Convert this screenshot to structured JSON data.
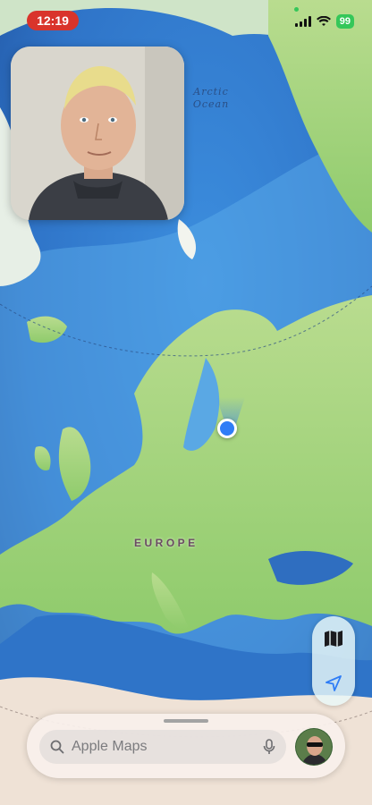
{
  "status_bar": {
    "time": "12:19",
    "battery": "99"
  },
  "map": {
    "ocean_label_line1": "Arctic",
    "ocean_label_line2": "Ocean",
    "region_label": "EUROPE"
  },
  "pip": {
    "icon": "person-video-icon"
  },
  "controls": {
    "map_mode_icon": "map-icon",
    "location_icon": "location-arrow-icon"
  },
  "search": {
    "placeholder": "Apple Maps",
    "icon": "search-icon",
    "voice_icon": "microphone-icon"
  },
  "colors": {
    "accent": "#2f7df6",
    "status_pill": "#d9342b",
    "battery": "#35c759"
  }
}
